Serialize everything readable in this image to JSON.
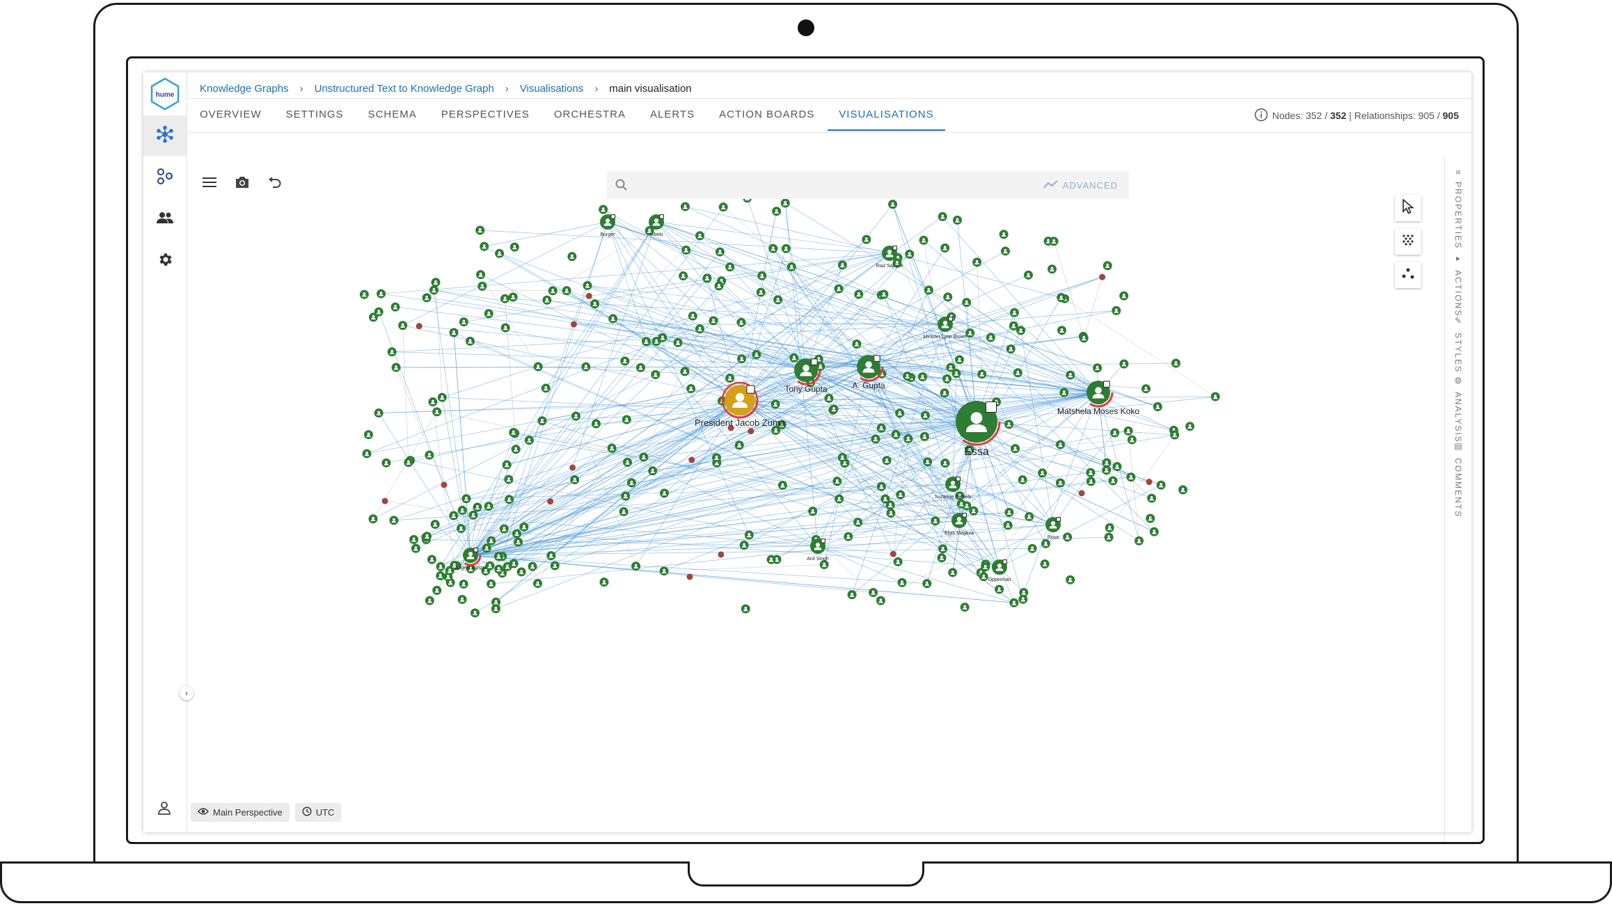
{
  "app": {
    "logo_text": "hume",
    "nav": [
      {
        "icon": "graph-network-icon",
        "active": true
      },
      {
        "icon": "nodes-icon",
        "active": false
      },
      {
        "icon": "users-icon",
        "active": false
      },
      {
        "icon": "gear-icon",
        "active": false
      }
    ]
  },
  "breadcrumbs": {
    "items": [
      "Knowledge Graphs",
      "Unstructured Text to Knowledge Graph",
      "Visualisations"
    ],
    "current": "main visualisation"
  },
  "tabs": [
    "OVERVIEW",
    "SETTINGS",
    "SCHEMA",
    "PERSPECTIVES",
    "ORCHESTRA",
    "ALERTS",
    "ACTION BOARDS",
    "VISUALISATIONS"
  ],
  "active_tab": "VISUALISATIONS",
  "counts": {
    "nodes_label": "Nodes:",
    "nodes_visible": "352",
    "sep1": "/",
    "nodes_total": "352",
    "divider": "|",
    "rels_label": "Relationships:",
    "rels_visible": "905",
    "sep2": "/",
    "rels_total": "905"
  },
  "search": {
    "placeholder": "",
    "advanced_label": "ADVANCED"
  },
  "right_panel": [
    "PROPERTIES",
    "ACTIONS",
    "STYLES",
    "ANALYSIS",
    "COMMENTS"
  ],
  "footer": {
    "perspective": "Main Perspective",
    "timezone": "UTC"
  },
  "graph": {
    "colors": {
      "person": "#2e7d32",
      "highlight": "#d4a017",
      "ring": "#e53935",
      "edge": "#3d8fd6",
      "small": "#a0463c"
    },
    "key_nodes": [
      {
        "label": "President Jacob Zuma",
        "size": "large",
        "kind": "highlight"
      },
      {
        "label": "Essa",
        "size": "xlarge",
        "kind": "person"
      },
      {
        "label": "Tony Gupta",
        "size": "medium",
        "kind": "person"
      },
      {
        "label": "A. Gupta",
        "size": "medium",
        "kind": "person"
      },
      {
        "label": "Matshela Moses Koko",
        "size": "medium",
        "kind": "person"
      },
      {
        "label": "Riaz Salojee",
        "size": "small",
        "kind": "person"
      },
      {
        "label": "Minister Lynn Brown",
        "size": "small",
        "kind": "person"
      },
      {
        "label": "Angelo Agrizzi",
        "size": "small",
        "kind": "person"
      },
      {
        "label": "Roux",
        "size": "small",
        "kind": "person"
      },
      {
        "label": "Opperman",
        "size": "small",
        "kind": "person"
      },
      {
        "label": "Suzanne Daniels",
        "size": "small",
        "kind": "person"
      },
      {
        "label": "Anil Singh",
        "size": "small",
        "kind": "person"
      },
      {
        "label": "Burger",
        "size": "small",
        "kind": "person"
      },
      {
        "label": "Mbeki",
        "size": "small",
        "kind": "person"
      },
      {
        "label": "Elias Mageza",
        "size": "small",
        "kind": "person"
      }
    ]
  }
}
